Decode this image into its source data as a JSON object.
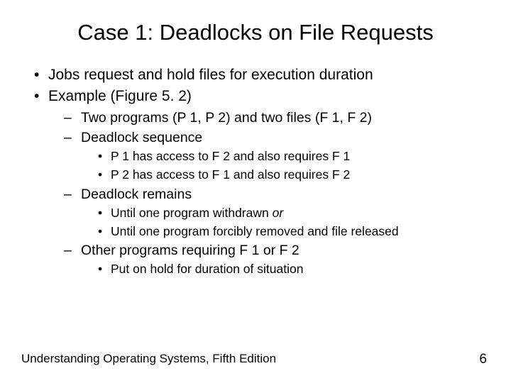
{
  "title": "Case 1: Deadlocks on File Requests",
  "bullets": {
    "l1a": "Jobs request and hold files for execution duration",
    "l1b": "Example (Figure 5. 2)",
    "l2a": "Two programs (P 1, P 2) and two files (F 1, F 2)",
    "l2b": "Deadlock sequence",
    "l3a": "P 1 has access to F 2 and also requires F 1",
    "l3b": "P 2 has access to F 1 and also requires F 2",
    "l2c": "Deadlock remains",
    "l3c_pre": "Until one program withdrawn ",
    "l3c_it": "or",
    "l3d": "Until one program forcibly removed and file released",
    "l2d": "Other programs requiring F 1 or F 2",
    "l3e": "Put on hold for duration of situation"
  },
  "footer": "Understanding Operating Systems, Fifth Edition",
  "page": "6"
}
